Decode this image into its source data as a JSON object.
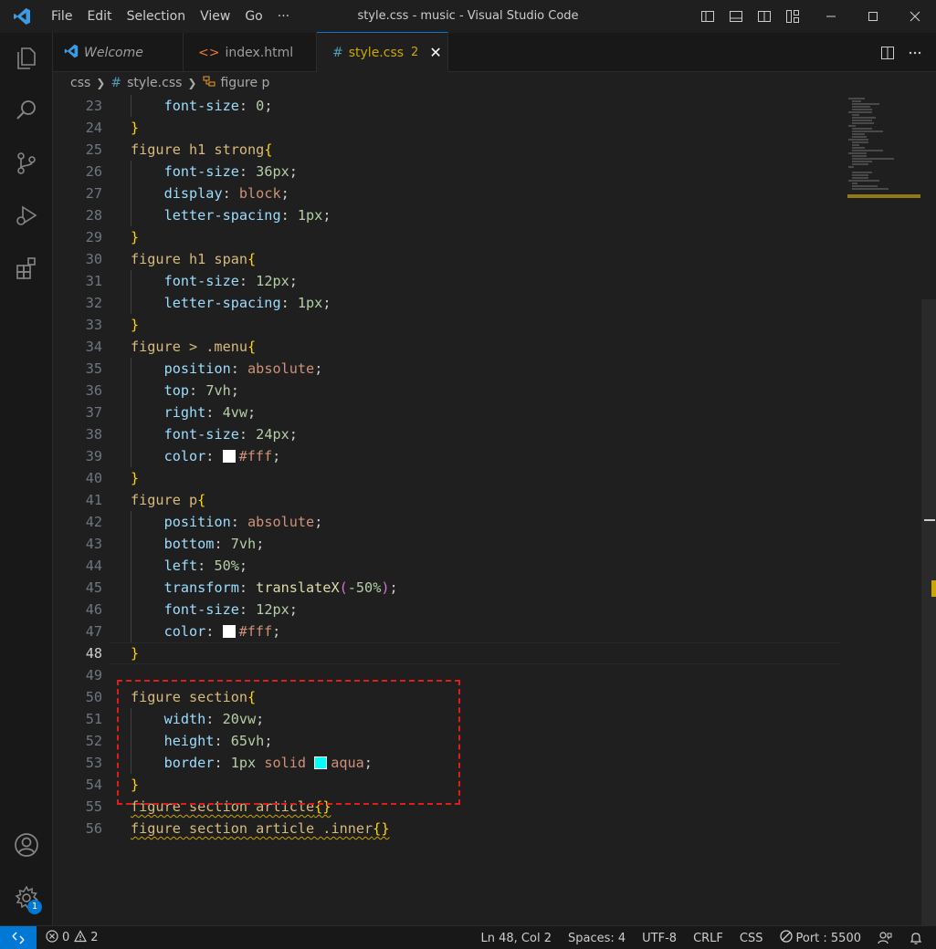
{
  "window": {
    "title": "style.css - music - Visual Studio Code"
  },
  "menu": [
    "File",
    "Edit",
    "Selection",
    "View",
    "Go",
    "···"
  ],
  "tabs": [
    {
      "label": "Welcome",
      "icon": "vscode-logo-icon",
      "active": false
    },
    {
      "label": "index.html",
      "icon": "html-icon",
      "active": false
    },
    {
      "label": "style.css",
      "icon": "css-hash-icon",
      "active": true,
      "problems": "2"
    }
  ],
  "breadcrumb": {
    "folder": "css",
    "file": "style.css",
    "symbol": "figure p"
  },
  "editor": {
    "current_line": 48,
    "lines": [
      {
        "n": "23",
        "segs": [
          [
            "    ",
            "punc"
          ],
          [
            "font-size",
            "prop"
          ],
          [
            ": ",
            "punc"
          ],
          [
            "0",
            "num"
          ],
          [
            ";",
            "punc"
          ]
        ]
      },
      {
        "n": "24",
        "segs": [
          [
            "}",
            "brace"
          ]
        ]
      },
      {
        "n": "25",
        "segs": [
          [
            "figure h1 strong",
            "sel"
          ],
          [
            "{",
            "brace"
          ]
        ]
      },
      {
        "n": "26",
        "segs": [
          [
            "    ",
            "punc"
          ],
          [
            "font-size",
            "prop"
          ],
          [
            ": ",
            "punc"
          ],
          [
            "36px",
            "num"
          ],
          [
            ";",
            "punc"
          ]
        ]
      },
      {
        "n": "27",
        "segs": [
          [
            "    ",
            "punc"
          ],
          [
            "display",
            "prop"
          ],
          [
            ": ",
            "punc"
          ],
          [
            "block",
            "val"
          ],
          [
            ";",
            "punc"
          ]
        ]
      },
      {
        "n": "28",
        "segs": [
          [
            "    ",
            "punc"
          ],
          [
            "letter-spacing",
            "prop"
          ],
          [
            ": ",
            "punc"
          ],
          [
            "1px",
            "num"
          ],
          [
            ";",
            "punc"
          ]
        ]
      },
      {
        "n": "29",
        "segs": [
          [
            "}",
            "brace"
          ]
        ]
      },
      {
        "n": "30",
        "segs": [
          [
            "figure h1 span",
            "sel"
          ],
          [
            "{",
            "brace"
          ]
        ]
      },
      {
        "n": "31",
        "segs": [
          [
            "    ",
            "punc"
          ],
          [
            "font-size",
            "prop"
          ],
          [
            ": ",
            "punc"
          ],
          [
            "12px",
            "num"
          ],
          [
            ";",
            "punc"
          ]
        ]
      },
      {
        "n": "32",
        "segs": [
          [
            "    ",
            "punc"
          ],
          [
            "letter-spacing",
            "prop"
          ],
          [
            ": ",
            "punc"
          ],
          [
            "1px",
            "num"
          ],
          [
            ";",
            "punc"
          ]
        ]
      },
      {
        "n": "33",
        "segs": [
          [
            "}",
            "brace"
          ]
        ]
      },
      {
        "n": "34",
        "segs": [
          [
            "figure > .menu",
            "sel"
          ],
          [
            "{",
            "brace"
          ]
        ]
      },
      {
        "n": "35",
        "segs": [
          [
            "    ",
            "punc"
          ],
          [
            "position",
            "prop"
          ],
          [
            ": ",
            "punc"
          ],
          [
            "absolute",
            "val"
          ],
          [
            ";",
            "punc"
          ]
        ]
      },
      {
        "n": "36",
        "segs": [
          [
            "    ",
            "punc"
          ],
          [
            "top",
            "prop"
          ],
          [
            ": ",
            "punc"
          ],
          [
            "7vh",
            "num"
          ],
          [
            ";",
            "punc"
          ]
        ]
      },
      {
        "n": "37",
        "segs": [
          [
            "    ",
            "punc"
          ],
          [
            "right",
            "prop"
          ],
          [
            ": ",
            "punc"
          ],
          [
            "4vw",
            "num"
          ],
          [
            ";",
            "punc"
          ]
        ]
      },
      {
        "n": "38",
        "segs": [
          [
            "    ",
            "punc"
          ],
          [
            "font-size",
            "prop"
          ],
          [
            ": ",
            "punc"
          ],
          [
            "24px",
            "num"
          ],
          [
            ";",
            "punc"
          ]
        ]
      },
      {
        "n": "39",
        "segs": [
          [
            "    ",
            "punc"
          ],
          [
            "color",
            "prop"
          ],
          [
            ": ",
            "punc"
          ],
          [
            "#ffffff",
            "swatch"
          ],
          [
            "#fff",
            "val"
          ],
          [
            ";",
            "punc"
          ]
        ]
      },
      {
        "n": "40",
        "segs": [
          [
            "}",
            "brace"
          ]
        ]
      },
      {
        "n": "41",
        "segs": [
          [
            "figure p",
            "sel"
          ],
          [
            "{",
            "brace"
          ]
        ]
      },
      {
        "n": "42",
        "segs": [
          [
            "    ",
            "punc"
          ],
          [
            "position",
            "prop"
          ],
          [
            ": ",
            "punc"
          ],
          [
            "absolute",
            "val"
          ],
          [
            ";",
            "punc"
          ]
        ]
      },
      {
        "n": "43",
        "segs": [
          [
            "    ",
            "punc"
          ],
          [
            "bottom",
            "prop"
          ],
          [
            ": ",
            "punc"
          ],
          [
            "7vh",
            "num"
          ],
          [
            ";",
            "punc"
          ]
        ]
      },
      {
        "n": "44",
        "segs": [
          [
            "    ",
            "punc"
          ],
          [
            "left",
            "prop"
          ],
          [
            ": ",
            "punc"
          ],
          [
            "50%",
            "num"
          ],
          [
            ";",
            "punc"
          ]
        ]
      },
      {
        "n": "45",
        "segs": [
          [
            "    ",
            "punc"
          ],
          [
            "transform",
            "prop"
          ],
          [
            ": ",
            "punc"
          ],
          [
            "translateX",
            "fn"
          ],
          [
            "(",
            "paren"
          ],
          [
            "-50%",
            "num"
          ],
          [
            ")",
            "paren"
          ],
          [
            ";",
            "punc"
          ]
        ]
      },
      {
        "n": "46",
        "segs": [
          [
            "    ",
            "punc"
          ],
          [
            "font-size",
            "prop"
          ],
          [
            ": ",
            "punc"
          ],
          [
            "12px",
            "num"
          ],
          [
            ";",
            "punc"
          ]
        ]
      },
      {
        "n": "47",
        "segs": [
          [
            "    ",
            "punc"
          ],
          [
            "color",
            "prop"
          ],
          [
            ": ",
            "punc"
          ],
          [
            "#ffffff",
            "swatch"
          ],
          [
            "#fff",
            "val"
          ],
          [
            ";",
            "punc"
          ]
        ]
      },
      {
        "n": "48",
        "segs": [
          [
            "}",
            "brace"
          ]
        ]
      },
      {
        "n": "49",
        "segs": []
      },
      {
        "n": "50",
        "segs": [
          [
            "figure section",
            "sel"
          ],
          [
            "{",
            "brace"
          ]
        ]
      },
      {
        "n": "51",
        "segs": [
          [
            "    ",
            "punc"
          ],
          [
            "width",
            "prop"
          ],
          [
            ": ",
            "punc"
          ],
          [
            "20vw",
            "num"
          ],
          [
            ";",
            "punc"
          ]
        ]
      },
      {
        "n": "52",
        "segs": [
          [
            "    ",
            "punc"
          ],
          [
            "height",
            "prop"
          ],
          [
            ": ",
            "punc"
          ],
          [
            "65vh",
            "num"
          ],
          [
            ";",
            "punc"
          ]
        ]
      },
      {
        "n": "53",
        "segs": [
          [
            "    ",
            "punc"
          ],
          [
            "border",
            "prop"
          ],
          [
            ": ",
            "punc"
          ],
          [
            "1px",
            "num"
          ],
          [
            " ",
            "punc"
          ],
          [
            "solid",
            "val"
          ],
          [
            " ",
            "punc"
          ],
          [
            "#00ffff",
            "swatch"
          ],
          [
            "aqua",
            "val"
          ],
          [
            ";",
            "punc"
          ]
        ]
      },
      {
        "n": "54",
        "segs": [
          [
            "}",
            "brace"
          ]
        ]
      },
      {
        "n": "55",
        "segs": [
          [
            "figure section article",
            "sel squiggle"
          ],
          [
            "{}",
            "brace squiggle"
          ]
        ]
      },
      {
        "n": "56",
        "segs": [
          [
            "figure section article .inner",
            "sel squiggle"
          ],
          [
            "{}",
            "brace squiggle"
          ]
        ]
      }
    ]
  },
  "statusbar": {
    "errors": "0",
    "warnings": "2",
    "position": "Ln 48, Col 2",
    "spaces": "Spaces: 4",
    "encoding": "UTF-8",
    "eol": "CRLF",
    "language": "CSS",
    "port": "Port : 5500"
  },
  "activity": {
    "settings_badge": "1"
  },
  "colors": {
    "accent": "#0078d4",
    "selector": "#d7ba7d",
    "property": "#9cdcfe",
    "number": "#b5cea8",
    "string_value": "#ce9178",
    "highlight_box": "#e01c1c"
  }
}
